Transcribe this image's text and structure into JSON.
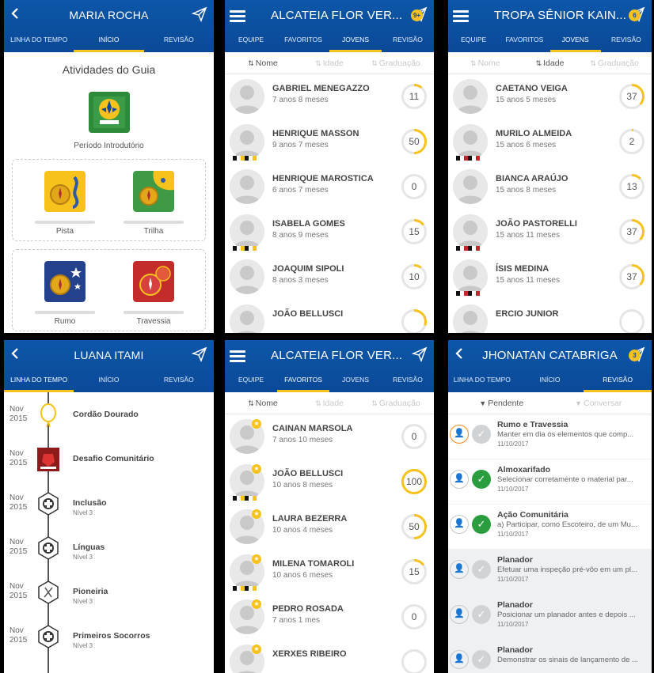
{
  "colors": {
    "header": "#0a4a98",
    "accent": "#f6c21b",
    "ring_track": "#e5e5e5",
    "check_green": "#2a9d3f",
    "orange": "#f08a24"
  },
  "p1": {
    "title": "MARIA ROCHA",
    "tabs": [
      "LINHA DO TEMPO",
      "INÍCIO",
      "REVISÃO"
    ],
    "section_title": "Atividades do Guia",
    "intro_label": "Período Introdutório",
    "cards": [
      "Pista",
      "Trilha",
      "Rumo",
      "Travessia"
    ]
  },
  "p2": {
    "title": "ALCATEIA FLOR VER...",
    "badge": "9+",
    "tabs": [
      "EQUIPE",
      "FAVORITOS",
      "JOVENS",
      "REVISÃO"
    ],
    "sort": [
      "Nome",
      "Idade",
      "Graduação"
    ],
    "rows": [
      {
        "name": "GABRIEL MENEGAZZO",
        "age": "7 anos 8 meses",
        "value": 11,
        "progress": 0.11,
        "flag": ""
      },
      {
        "name": "HENRIQUE MASSON",
        "age": "9 anos 7 meses",
        "value": 50,
        "progress": 0.5,
        "flag": "y"
      },
      {
        "name": "HENRIQUE MAROSTICA",
        "age": "6 anos 7 meses",
        "value": 0,
        "progress": 0,
        "flag": ""
      },
      {
        "name": "ISABELA GOMES",
        "age": "8 anos 9 meses",
        "value": 15,
        "progress": 0.15,
        "flag": "y"
      },
      {
        "name": "JOAQUIM SIPOLI",
        "age": "8 anos 3 meses",
        "value": 10,
        "progress": 0.1,
        "flag": ""
      },
      {
        "name": "JOÃO BELLUSCI",
        "age": "",
        "value": "",
        "progress": 0.3,
        "flag": ""
      }
    ]
  },
  "p3": {
    "title": "TROPA SÊNIOR KAIN...",
    "badge": "6",
    "tabs": [
      "EQUIPE",
      "FAVORITOS",
      "JOVENS",
      "REVISÃO"
    ],
    "sort": [
      "Nome",
      "Idade",
      "Graduação"
    ],
    "rows": [
      {
        "name": "CAETANO VEIGA",
        "age": "15 anos 5 meses",
        "value": 37,
        "progress": 0.37,
        "flag": ""
      },
      {
        "name": "MURILO ALMEIDA",
        "age": "15 anos 6 meses",
        "value": 2,
        "progress": 0.02,
        "flag": "r"
      },
      {
        "name": "BIANCA ARAÚJO",
        "age": "15 anos 8 meses",
        "value": 13,
        "progress": 0.13,
        "flag": ""
      },
      {
        "name": "JOÃO PASTORELLI",
        "age": "15 anos 11 meses",
        "value": 37,
        "progress": 0.37,
        "flag": "r"
      },
      {
        "name": "ÍSIS MEDINA",
        "age": "15 anos 11 meses",
        "value": 37,
        "progress": 0.37,
        "flag": "r"
      },
      {
        "name": "ERCIO JUNIOR",
        "age": "",
        "value": "",
        "progress": 0,
        "flag": ""
      }
    ]
  },
  "p4": {
    "title": "LUANA ITAMI",
    "tabs": [
      "LINHA DO TEMPO",
      "INÍCIO",
      "REVISÃO"
    ],
    "items": [
      {
        "month": "Nov",
        "year": "2015",
        "title": "Cordão Dourado",
        "sub": "",
        "icon": "cord-icon"
      },
      {
        "month": "Nov",
        "year": "2015",
        "title": "Desafio Comunitário",
        "sub": "",
        "icon": "challenge-icon"
      },
      {
        "month": "Nov",
        "year": "2015",
        "title": "Inclusão",
        "sub": "Nível 3",
        "icon": "hex-cross-icon"
      },
      {
        "month": "Nov",
        "year": "2015",
        "title": "Línguas",
        "sub": "Nível 3",
        "icon": "hex-cross-icon"
      },
      {
        "month": "Nov",
        "year": "2015",
        "title": "Pioneiria",
        "sub": "Nível 3",
        "icon": "hex-tool-icon"
      },
      {
        "month": "Nov",
        "year": "2015",
        "title": "Primeiros Socorros",
        "sub": "Nível 3",
        "icon": "hex-cross-icon"
      }
    ]
  },
  "p5": {
    "title": "ALCATEIA FLOR VER...",
    "tabs": [
      "EQUIPE",
      "FAVORITOS",
      "JOVENS",
      "REVISÃO"
    ],
    "sort": [
      "Nome",
      "Idade",
      "Graduação"
    ],
    "rows": [
      {
        "name": "CAINAN MARSOLA",
        "age": "7 anos 10 meses",
        "value": 0,
        "progress": 0,
        "flag": ""
      },
      {
        "name": "JOÃO BELLUSCI",
        "age": "10 anos 8 meses",
        "value": 100,
        "progress": 1,
        "flag": "y"
      },
      {
        "name": "LAURA BEZERRA",
        "age": "10 anos 4 meses",
        "value": 50,
        "progress": 0.5,
        "flag": ""
      },
      {
        "name": "MILENA TOMAROLI",
        "age": "10 anos 6 meses",
        "value": 15,
        "progress": 0.15,
        "flag": "y"
      },
      {
        "name": "PEDRO ROSADA",
        "age": "7 anos 1 mes",
        "value": 0,
        "progress": 0,
        "flag": ""
      },
      {
        "name": "XERXES RIBEIRO",
        "age": "",
        "value": "",
        "progress": 0,
        "flag": ""
      }
    ]
  },
  "p6": {
    "title": "JHONATAN CATABRIGA",
    "badge": "3",
    "tabs": [
      "LINHA DO TEMPO",
      "INÍCIO",
      "REVISÃO"
    ],
    "filters": [
      "Pendente",
      "Conversar"
    ],
    "items": [
      {
        "title": "Rumo e Travessia",
        "desc": "Manter em dia os elementos que comp...",
        "date": "11/10/2017",
        "state": "pending",
        "orange": true
      },
      {
        "title": "Almoxarifado",
        "desc": "Selecionar corretamente o material par...",
        "date": "11/10/2017",
        "state": "done",
        "orange": false
      },
      {
        "title": "Ação Comunitária",
        "desc": "a) Participar, como Escoteiro, de um Mu...",
        "date": "11/10/2017",
        "state": "done",
        "orange": false
      },
      {
        "title": "Planador",
        "desc": "Efetuar uma inspeção pré-vôo em um pl...",
        "date": "11/10/2017",
        "state": "pending",
        "orange": false
      },
      {
        "title": "Planador",
        "desc": "Posicionar um planador antes e depois ...",
        "date": "11/10/2017",
        "state": "pending",
        "orange": false
      },
      {
        "title": "Planador",
        "desc": "Demonstrar os sinais de lançamento de ...",
        "date": "",
        "state": "pending",
        "orange": false
      }
    ]
  }
}
